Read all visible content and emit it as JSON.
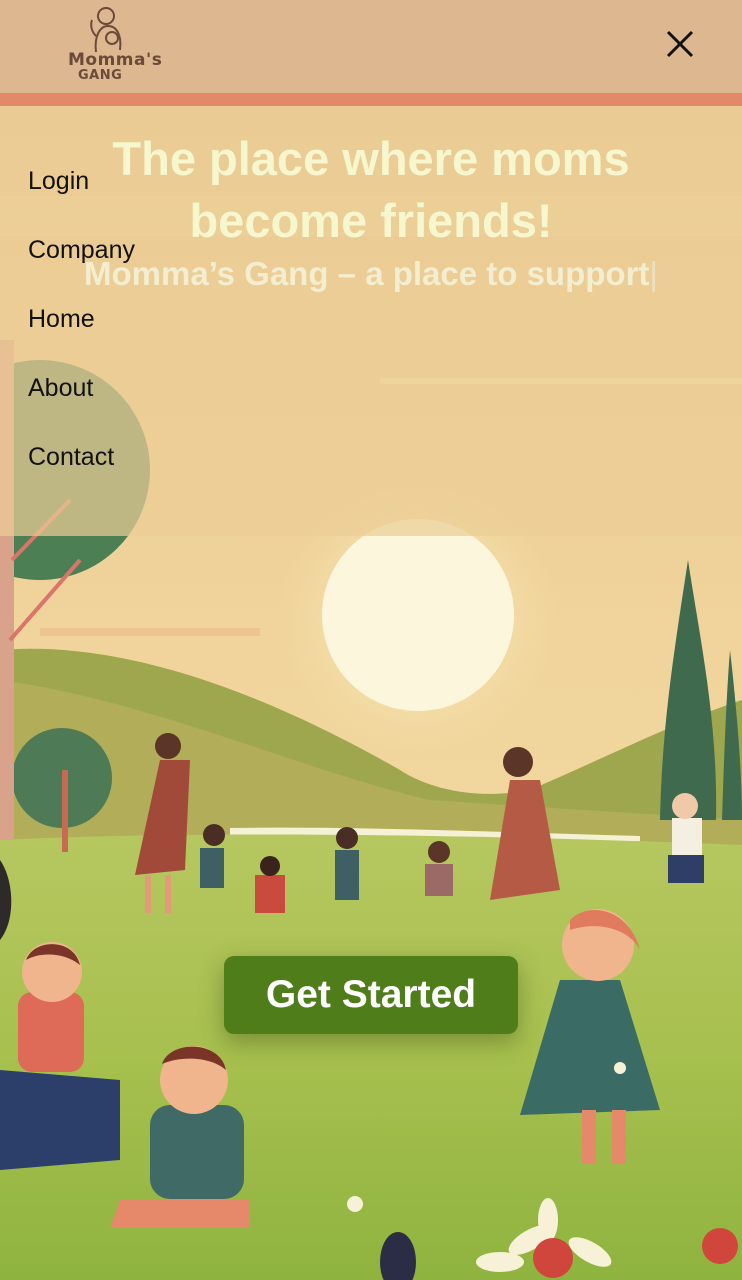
{
  "header": {
    "logo": {
      "line1": "Momma's",
      "line2": "GANG"
    },
    "close_icon": "close-icon"
  },
  "menu": {
    "items": [
      {
        "label": "Login"
      },
      {
        "label": "Company"
      },
      {
        "label": "Home"
      },
      {
        "label": "About"
      },
      {
        "label": "Contact"
      }
    ]
  },
  "hero": {
    "title": "The place where moms become friends!",
    "subtitle": "Momma’s Gang – a place to  support",
    "cursor": "|"
  },
  "cta": {
    "label": "Get Started"
  },
  "colors": {
    "header_bg": "#ddb78f",
    "header_stripe": "#e28a68",
    "cta_bg": "#4f7d1a",
    "title_text": "#f6f7cf"
  }
}
